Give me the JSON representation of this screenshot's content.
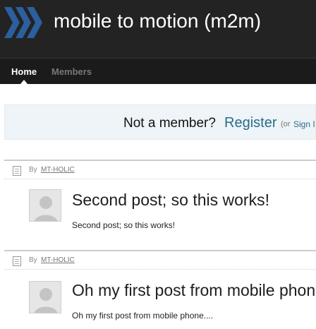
{
  "header": {
    "site_title": "mobile to motion (m2m)",
    "logo_icon": "chevrons-logo-icon",
    "logo_color": "#2b5f9e"
  },
  "nav": {
    "items": [
      {
        "label": "Home",
        "active": true
      },
      {
        "label": "Members",
        "active": false
      }
    ]
  },
  "join_banner": {
    "question": "Not a member?",
    "register_label": "Register",
    "or_label": "(or",
    "sign_in_label": "Sign In"
  },
  "posts": [
    {
      "by_label": "By",
      "author": "MT-HOLIC",
      "title": "Second post; so this works!",
      "body": "Second post; so this works!"
    },
    {
      "by_label": "By",
      "author": "MT-HOLIC",
      "title": "Oh my first post from mobile phone",
      "body": "Oh my first post from mobile phone...."
    }
  ]
}
